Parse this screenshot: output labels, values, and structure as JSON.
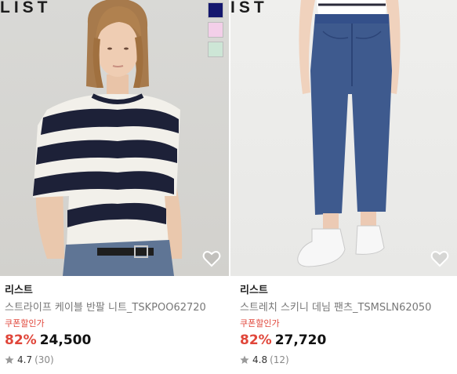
{
  "products": [
    {
      "brand_logo": "LIST",
      "brand": "리스트",
      "name": "스트라이프 케이블 반팔 니트_TSKPOO62720",
      "coupon_label": "쿠폰할인가",
      "discount": "82%",
      "price": "24,500",
      "rating": "4.7",
      "reviews": "(30)",
      "swatches": [
        "#14176e",
        "#f3cfe9",
        "#cde6d6"
      ]
    },
    {
      "brand_logo": "IST",
      "brand": "리스트",
      "name": "스트레치 스키니 데님 팬츠_TSMSLN62050",
      "coupon_label": "쿠폰할인가",
      "discount": "82%",
      "price": "27,720",
      "rating": "4.8",
      "reviews": "(12)"
    }
  ],
  "colors": {
    "accent": "#e0463a",
    "star": "#9a9a9a"
  }
}
